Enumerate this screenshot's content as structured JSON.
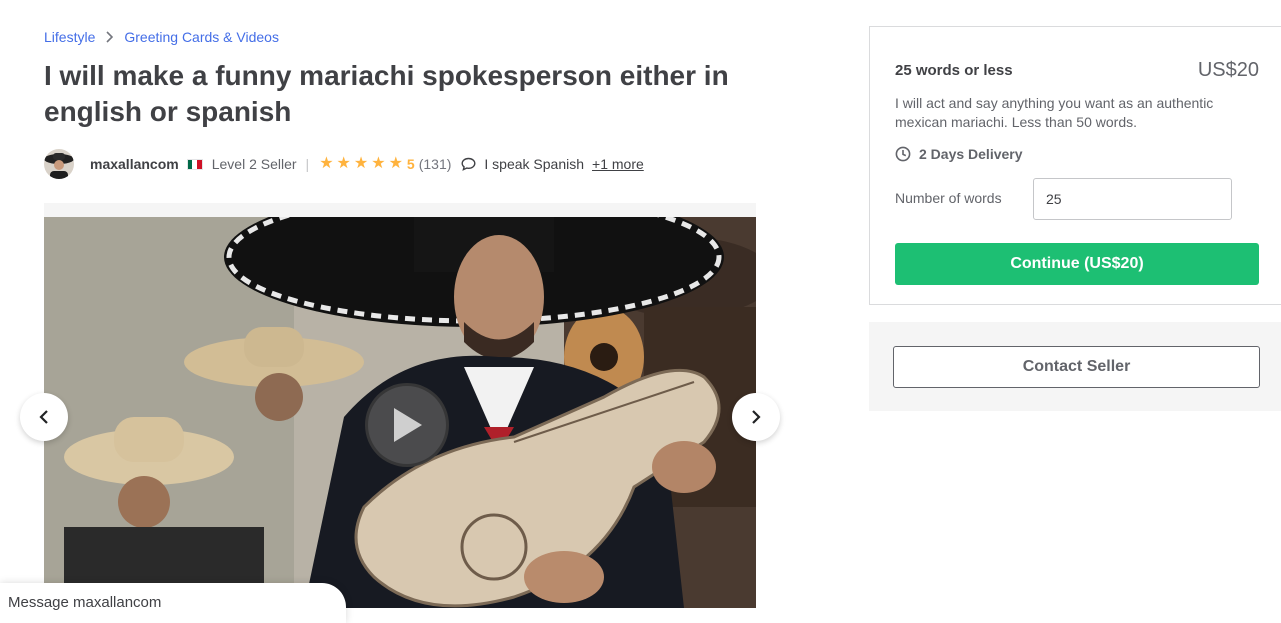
{
  "breadcrumb": {
    "items": [
      "Lifestyle",
      "Greeting Cards & Videos"
    ]
  },
  "gig": {
    "title": "I will make a funny mariachi spokesperson either in english or spanish"
  },
  "seller": {
    "name": "maxallancom",
    "level": "Level 2 Seller",
    "rating": "5",
    "rating_value": 5,
    "reviews": "(131)",
    "languages": "I speak Spanish",
    "more_languages": "+1 more"
  },
  "package": {
    "name": "25 words or less",
    "price": "US$20",
    "description": "I will act and say anything you want as an authentic mexican mariachi. Less than 50 words.",
    "delivery": "2 Days Delivery",
    "words_label": "Number of words",
    "words_value": "25",
    "continue_label": "Continue (US$20)"
  },
  "contact": {
    "button_label": "Contact Seller"
  },
  "message_bar": {
    "label": "Message maxallancom"
  },
  "colors": {
    "accent_green": "#1dbf73",
    "link_blue": "#446ee7",
    "star": "#ffb33e",
    "text_dark": "#404145"
  },
  "icons": [
    "chevron-right-icon",
    "star-icon",
    "chat-bubble-icon",
    "clock-icon",
    "play-icon",
    "chevron-left-icon",
    "mexico-flag-icon"
  ]
}
